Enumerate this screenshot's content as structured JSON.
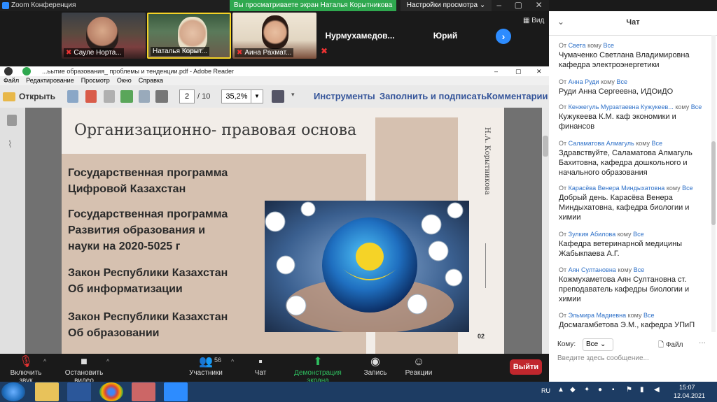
{
  "zoom": {
    "window_title": "Zoom Конференция",
    "share_banner": "Вы просматриваете экран Наталья Корытникова",
    "view_settings": "Настройки просмотра",
    "view_label": "Вид",
    "participants": [
      {
        "name": "Сауле Норта..."
      },
      {
        "name": "Наталья Корыт..."
      },
      {
        "name": "Аина Рахмат..."
      },
      {
        "name": "Нурмухамедов..."
      },
      {
        "name": "Юрий"
      }
    ],
    "bar": {
      "mute_label": "Включить звук",
      "video_label": "Остановить видео",
      "participants_label": "Участники",
      "participants_count": "56",
      "chat_label": "Чат",
      "share_label": "Демонстрация экрана",
      "record_label": "Запись",
      "reactions_label": "Реакции",
      "leave_label": "Выйти"
    }
  },
  "adobe": {
    "window_title": "...ьытие образования_ проблемы и тенденции.pdf - Adobe Reader",
    "menu": [
      "Файл",
      "Редактирование",
      "Просмотр",
      "Окно",
      "Справка"
    ],
    "open_label": "Открыть",
    "current_page": "2",
    "total_pages": "/ 10",
    "zoom": "35,2%",
    "tools": "Инструменты",
    "fill_sign": "Заполнить и подписать",
    "comments": "Комментарии"
  },
  "slide": {
    "title": "Организационно- правовая основа",
    "bullets": [
      [
        "Государственная программа",
        "Цифровой Казахстан"
      ],
      [
        "Государственная программа",
        "Развития образования и",
        "науки на 2020-5025 г"
      ],
      [
        "Закон Республики Казахстан",
        "Об информатизации"
      ],
      [
        "Закон Республики Казахстан",
        "Об образовании"
      ]
    ],
    "author": "Н.А. Корытникова",
    "page_number": "02"
  },
  "chat": {
    "title": "Чат",
    "messages": [
      {
        "from": "Света",
        "to": "Все",
        "text": "Чумаченко Светлана Владимировна кафедра электроэнергетики"
      },
      {
        "from": "Анна Руди",
        "to": "Все",
        "text": "Руди Анна Сергеевна, ИДОиДО"
      },
      {
        "from": "Кенжегуль Мурзатаевна Кужукеев...",
        "to": "Все",
        "text": "Кужукеева К.М. каф экономики и финансов"
      },
      {
        "from": "Саламатова Алмагуль ",
        "to": "Все",
        "text": "Здравствуйте, Саламатова Алмагуль Бахитовна, кафедра дошкольного и начального образования"
      },
      {
        "from": "Карасёва Венера Миндыхатовна",
        "to": "Все",
        "text": "Добрый день. Карасёва Венера Миндыхатовна, кафедра биологии и химии"
      },
      {
        "from": "Зулкия Абилова",
        "to": "Все",
        "text": "Кафедра ветеринарной медицины Жабыкпаева А.Г."
      },
      {
        "from": "Аян Султановна",
        "to": "Все",
        "text": "Кожмухаметова Аян Султановна ст. преподаватель кафедры биологии и химии"
      },
      {
        "from": "Эльмира Мадиевна",
        "to": "Все",
        "text": "Досмагамбетова Э.М., кафедра УПиП"
      }
    ],
    "from_word": "От",
    "to_word": "кому",
    "to_label": "Кому:",
    "to_value": "Все",
    "file_label": "Файл",
    "input_placeholder": "Введите здесь сообщение..."
  },
  "taskbar": {
    "lang": "RU",
    "time": "15:07",
    "date": "12.04.2021"
  }
}
